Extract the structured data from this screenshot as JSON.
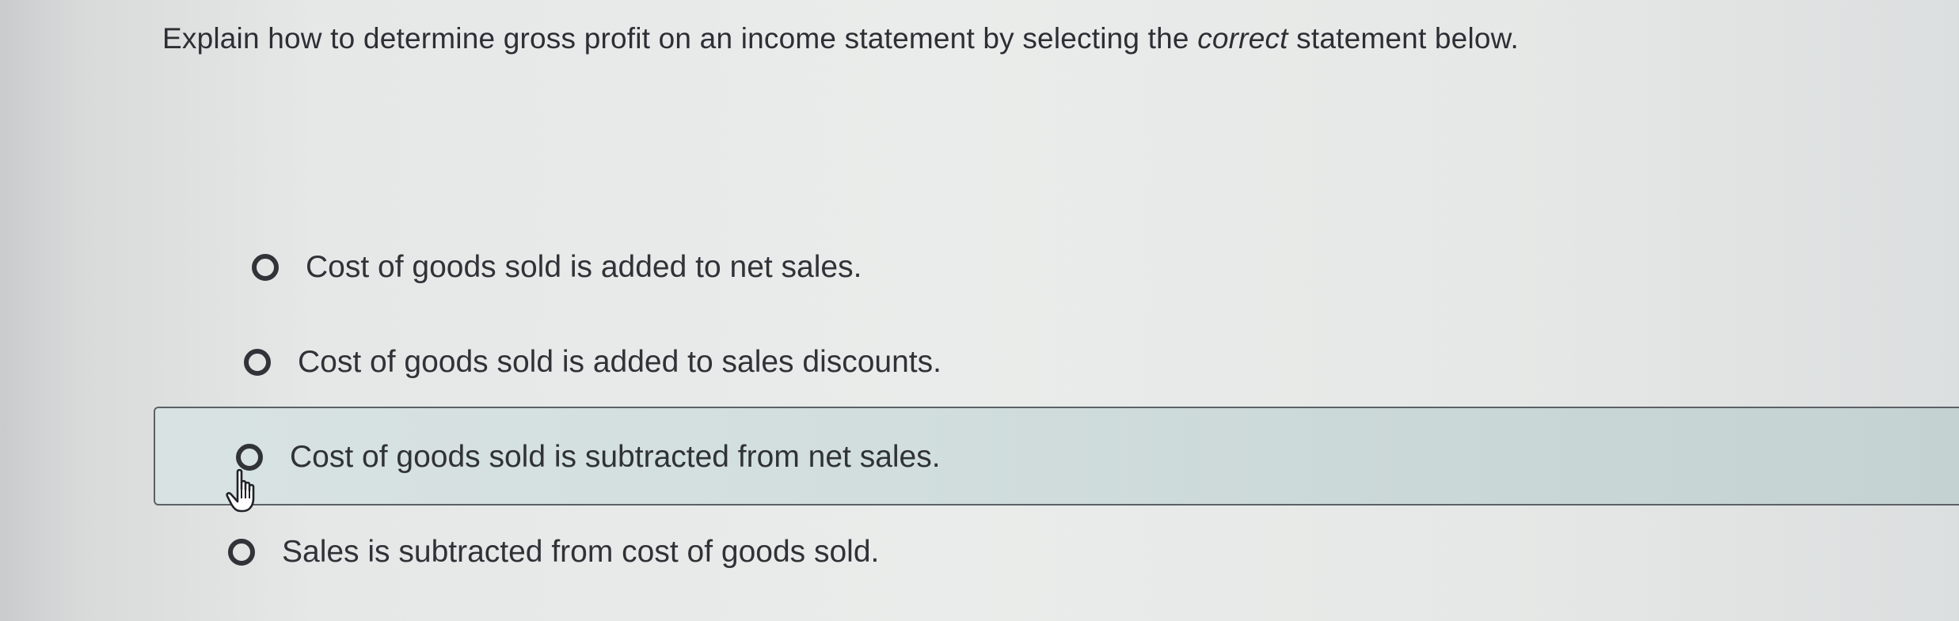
{
  "question": {
    "text_before": "Explain how to determine gross profit on an income statement by selecting the ",
    "emphasis": "correct",
    "text_after": " statement below."
  },
  "options": [
    {
      "label": "Cost of goods sold is added to net sales.",
      "selected": false
    },
    {
      "label": "Cost of goods sold is added to sales discounts.",
      "selected": false
    },
    {
      "label": "Cost of goods sold is subtracted from net sales.",
      "selected": false,
      "hovered": true
    },
    {
      "label": "Sales is subtracted from cost of goods sold.",
      "selected": false
    }
  ],
  "cursor": {
    "icon": "hand-pointer-icon"
  },
  "colors": {
    "text": "#2f3236",
    "hover_background": "#d2dede",
    "hover_border": "#5c6166"
  }
}
